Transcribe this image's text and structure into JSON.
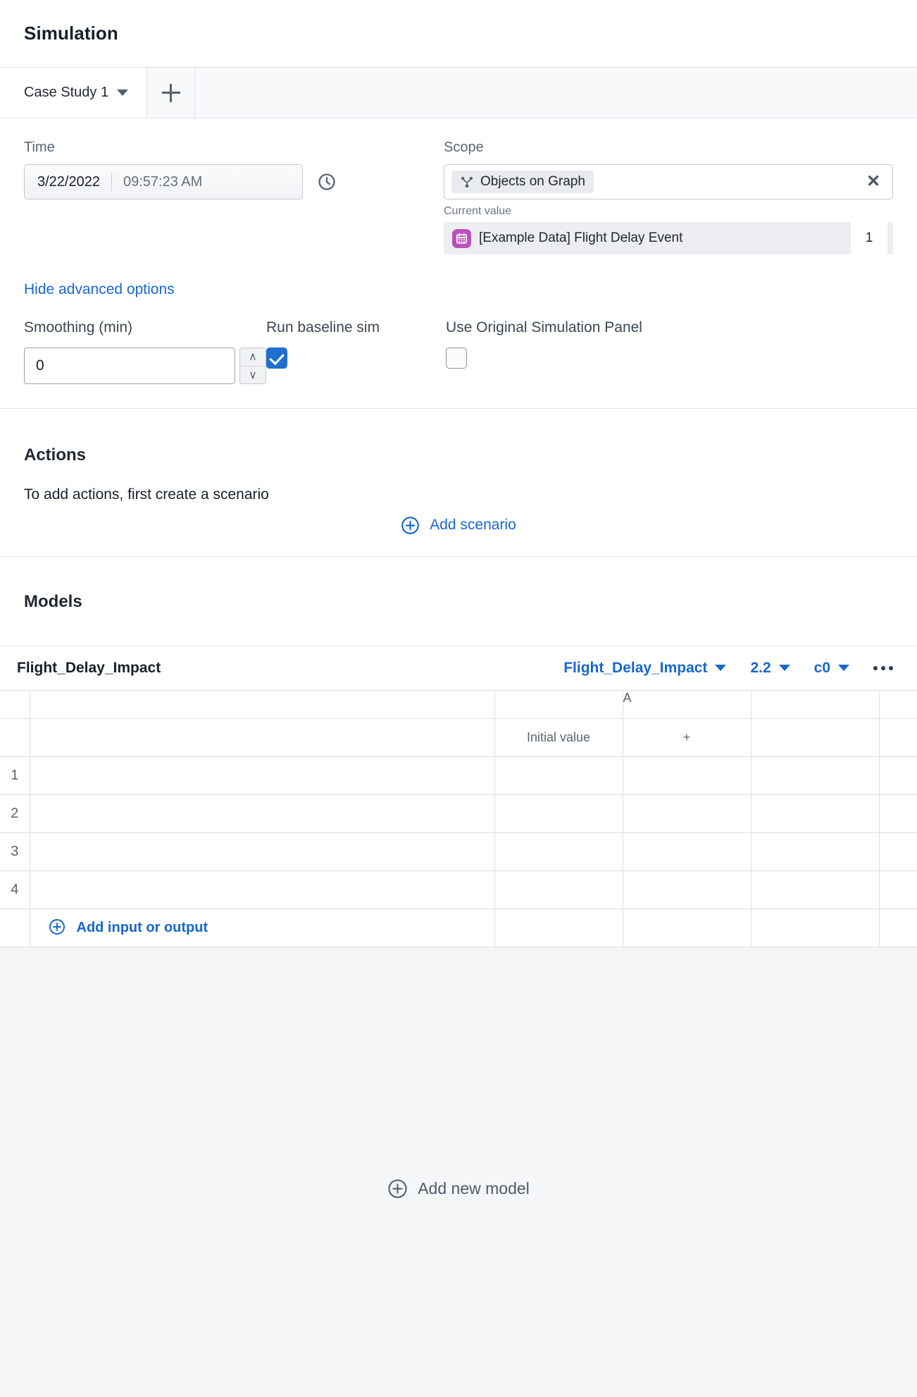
{
  "window": {
    "title": "Simulation"
  },
  "tabs": {
    "items": [
      {
        "label": "Case Study 1",
        "icon": "chevron-down-icon"
      }
    ],
    "add_label": "+",
    "add_icon": "plus-icon"
  },
  "time": {
    "label": "Time",
    "date": "3/22/2022",
    "time": "09:57:23 AM",
    "clock_icon": "clock-icon"
  },
  "scope": {
    "label": "Scope",
    "chip_label": "Objects on Graph",
    "chip_icon": "graph-node-icon",
    "clear_icon": "close-icon",
    "clear_label": "✕",
    "current_value_label": "Current value",
    "current_value": {
      "icon": "calendar-icon",
      "label": "[Example Data] Flight Delay Event",
      "count": "1",
      "icon_color": "#bc51bc"
    }
  },
  "advanced": {
    "toggle_label": "Hide advanced options",
    "smoothing_label": "Smoothing (min)",
    "smoothing_value": "0",
    "stepper_up_icon": "chevron-up-icon",
    "stepper_up": "∧",
    "stepper_down_icon": "chevron-down-icon",
    "stepper_down": "∨",
    "run_baseline_label": "Run baseline sim",
    "run_baseline_checked": true,
    "use_original_label": "Use Original Simulation Panel",
    "use_original_checked": false
  },
  "actions": {
    "title": "Actions",
    "hint": "To add actions, first create a scenario",
    "add_scenario_label": "Add scenario",
    "add_scenario_icon": "plus-circle-icon"
  },
  "models": {
    "title": "Models",
    "row": {
      "name": "Flight_Delay_Impact",
      "model_select": "Flight_Delay_Impact",
      "version_select": "2.2",
      "config_select": "c0",
      "overflow_icon": "kebab-menu-icon"
    },
    "grid": {
      "column_group_header": "A",
      "initial_value_header": "Initial value",
      "add_column_label": "+",
      "add_column_icon": "plus-icon",
      "rows": [
        {
          "num": "1",
          "name": "",
          "initial": "",
          "a": "",
          "b": ""
        },
        {
          "num": "2",
          "name": "",
          "initial": "",
          "a": "",
          "b": ""
        },
        {
          "num": "3",
          "name": "",
          "initial": "",
          "a": "",
          "b": ""
        },
        {
          "num": "4",
          "name": "",
          "initial": "",
          "a": "",
          "b": ""
        }
      ],
      "add_row_label": "Add input or output",
      "add_row_icon": "plus-circle-icon"
    },
    "add_model_label": "Add new model",
    "add_model_icon": "plus-circle-icon"
  },
  "colors": {
    "accent_blue": "#1767cf",
    "checkbox_blue": "#1f6fd0",
    "calendar_purple": "#bc51bc",
    "panel_bg": "#f4f6f8",
    "border": "#dfe3e8"
  }
}
